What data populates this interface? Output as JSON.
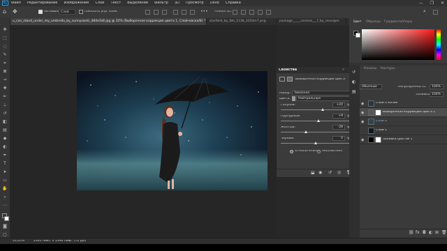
{
  "menu": {
    "app_icon": "Ps",
    "items": [
      "Файл",
      "Редактирование",
      "Изображение",
      "Слои",
      "Текст",
      "Выделение",
      "Фильтр",
      "3D",
      "Просмотр",
      "Окно",
      "Справка"
    ]
  },
  "window_controls": {
    "minimize": "—",
    "maximize": "❐",
    "close": "✕"
  },
  "options_bar": {
    "autoselect_label": "Автовыбор:",
    "autoselect_value": "Слой",
    "show_controls_label": "Показать упр. элем.",
    "mode_3d_label": "Режим 3D:"
  },
  "tabs": [
    {
      "label": "u_can_stand_under_my_umbrella_by_sunnysanki_d84e3s8.jpg @ 32% (Выборочная коррекция цвета 1, Слой-маска/8) *",
      "active": true
    },
    {
      "label": "starfield_by_tbh_1138_d35dm7.png",
      "active": false
    },
    {
      "label": "package_____cosmos___f_by_resurgen",
      "active": false
    }
  ],
  "properties": {
    "title": "Свойства",
    "subtitle": "Выборочная коррекция цвета",
    "preset_label": "Набор:",
    "preset_value": "Заказная",
    "colors_label": "Цвета:",
    "colors_value": "Нейтральные",
    "sliders": [
      {
        "label": "Голубой:",
        "value": "+20",
        "pct": "%",
        "position": 0.6
      },
      {
        "label": "Пурпурный:",
        "value": "+9",
        "pct": "%",
        "position": 0.545
      },
      {
        "label": "Желтый:",
        "value": "-28",
        "pct": "%",
        "position": 0.36
      },
      {
        "label": "Черный:",
        "value": "0",
        "pct": "%",
        "position": 0.5
      }
    ],
    "method_relative": "Относительная",
    "method_absolute": "Абсолютная",
    "method_selected": "relative"
  },
  "color_panel": {
    "tabs": [
      {
        "label": "Цвет",
        "active": true
      },
      {
        "label": "Образцы",
        "active": false
      },
      {
        "label": "Градиенты",
        "active": false
      },
      {
        "label": "Узоры",
        "active": false
      }
    ],
    "foreground": "#000000",
    "background": "#ffffff"
  },
  "layers_panel": {
    "tabs": [
      {
        "label": "Каналы",
        "active": false
      },
      {
        "label": "Контуры",
        "active": false
      }
    ],
    "blend_mode": "Обычные",
    "opacity_label": "Непрозрачность:",
    "opacity_value": "100%",
    "fill_label": "Заливка:",
    "fill_value": "100%",
    "layers": [
      {
        "name": "Слой 0 копия",
        "selected": false,
        "visible": true
      },
      {
        "name": "Выборочная коррекция цвета 1",
        "selected": true,
        "visible": true
      },
      {
        "name": "Слой 0",
        "selected": false,
        "visible": true
      },
      {
        "name": "Слой 1",
        "selected": false,
        "visible": false
      },
      {
        "name": "Заливка цветом 1",
        "selected": false,
        "visible": true
      }
    ]
  },
  "status": {
    "zoom": "31,65%",
    "doc_size": "2365 пикс. x 1396 пикс. (72 ppi)"
  },
  "colors": {
    "accent": "#31a8ff",
    "panel": "#3b3b3b",
    "canvas": "#262626"
  }
}
